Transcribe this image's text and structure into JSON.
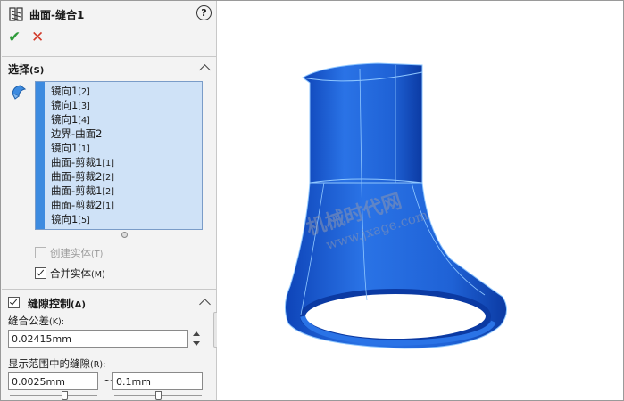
{
  "header": {
    "title": "曲面-缝合1",
    "help_label": "?",
    "feature_icon": "knit-feature-icon"
  },
  "actions": {
    "ok_glyph": "✔",
    "cancel_glyph": "✕",
    "ok_color": "#2e9b3a",
    "cancel_color": "#d23a2a"
  },
  "selection": {
    "title": "选择",
    "hotkey": "(S)",
    "items": [
      {
        "label": "镜向1",
        "suffix": "[2]"
      },
      {
        "label": "镜向1",
        "suffix": "[3]"
      },
      {
        "label": "镜向1",
        "suffix": "[4]"
      },
      {
        "label": "边界-曲面2",
        "suffix": ""
      },
      {
        "label": "镜向1",
        "suffix": "[1]"
      },
      {
        "label": "曲面-剪裁1",
        "suffix": "[1]"
      },
      {
        "label": "曲面-剪裁2",
        "suffix": "[2]"
      },
      {
        "label": "曲面-剪裁1",
        "suffix": "[2]"
      },
      {
        "label": "曲面-剪裁2",
        "suffix": "[1]"
      },
      {
        "label": "镜向1",
        "suffix": "[5]"
      }
    ],
    "create_solid": {
      "label": "创建实体",
      "hotkey": "(T)",
      "checked": false,
      "enabled": false
    },
    "merge_entities": {
      "label": "合并实体",
      "hotkey": "(M)",
      "checked": true,
      "enabled": true
    }
  },
  "gap_control": {
    "title": "缝隙控制",
    "hotkey": "(A)",
    "checked": true,
    "tolerance_label": "缝合公差",
    "tolerance_hotkey": "(K):",
    "tolerance_value": "0.02415mm",
    "range_label": "显示范围中的缝隙",
    "range_hotkey": "(R):",
    "range_min": "0.0025mm",
    "range_sep": "~",
    "range_max": "0.1mm"
  },
  "watermark": {
    "line1": "机械时代网",
    "line2": "www.jxage.com"
  },
  "colors": {
    "list_bg": "#cfe2f7",
    "list_accent": "#3d8be0",
    "model_blue": "#1c63d6",
    "model_edge": "#8fc7ff"
  }
}
